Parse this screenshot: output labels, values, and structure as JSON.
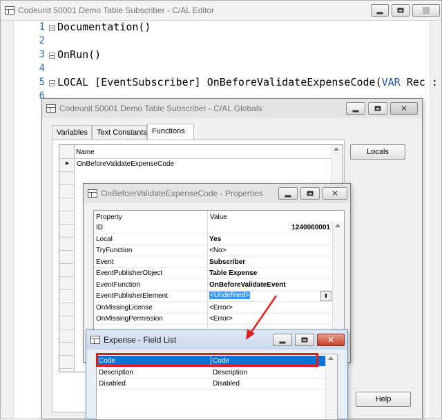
{
  "editor": {
    "title": "Codeunit 50001 Demo Table Subscriber - C/AL Editor",
    "lines": [
      {
        "num": "1",
        "text": "Documentation()",
        "fold": true
      },
      {
        "num": "2",
        "text": "",
        "fold": false
      },
      {
        "num": "3",
        "text": "OnRun()",
        "fold": true
      },
      {
        "num": "4",
        "text": "",
        "fold": false
      },
      {
        "num": "5",
        "text": "LOCAL [EventSubscriber] OnBeforeValidateExpenseCode(",
        "keyword": "VAR",
        "rest": " Rec : ",
        "fold": true
      },
      {
        "num": "6",
        "text": "",
        "fold": false
      }
    ]
  },
  "globals": {
    "title": "Codeunit 50001 Demo Table Subscriber - C/AL Globals",
    "tabs": [
      "Variables",
      "Text Constants",
      "Functions"
    ],
    "active_tab": "Functions",
    "column_name": "Name",
    "rows": [
      "OnBeforeValidateExpenseCode"
    ],
    "row_marker": "▸",
    "locals_button": "Locals",
    "help_button": "Help"
  },
  "properties": {
    "title": "OnBeforeValidateExpenseCode - Properties",
    "col_property": "Property",
    "col_value": "Value",
    "rows": [
      {
        "prop": "ID",
        "value": "1240060001",
        "bold": true,
        "align": "right"
      },
      {
        "prop": "Local",
        "value": "Yes",
        "bold": true
      },
      {
        "prop": "TryFunction",
        "value": "<No>",
        "bold": false
      },
      {
        "prop": "Event",
        "value": "Subscriber",
        "bold": true
      },
      {
        "prop": "EventPublisherObject",
        "value": "Table Expense",
        "bold": true
      },
      {
        "prop": "EventFunction",
        "value": "OnBeforeValidateEvent",
        "bold": true
      },
      {
        "prop": "EventPublisherElement",
        "value": "<Undefined>",
        "bold": false,
        "selected": true
      },
      {
        "prop": "OnMissingLicense",
        "value": "<Error>",
        "bold": false
      },
      {
        "prop": "OnMissingPermission",
        "value": "<Error>",
        "bold": false
      }
    ],
    "lookup_glyph": "⬆"
  },
  "fieldlist": {
    "title": "Expense - Field List",
    "rows": [
      {
        "field": "Code",
        "caption": "Code",
        "selected": true
      },
      {
        "field": "Description",
        "caption": "Description",
        "selected": false
      },
      {
        "field": "Disabled",
        "caption": "Disabled",
        "selected": false
      }
    ]
  },
  "colors": {
    "accent_highlight": "#3399ff",
    "selected_row": "#0a73d9",
    "annotation_red": "#e01e1e"
  }
}
